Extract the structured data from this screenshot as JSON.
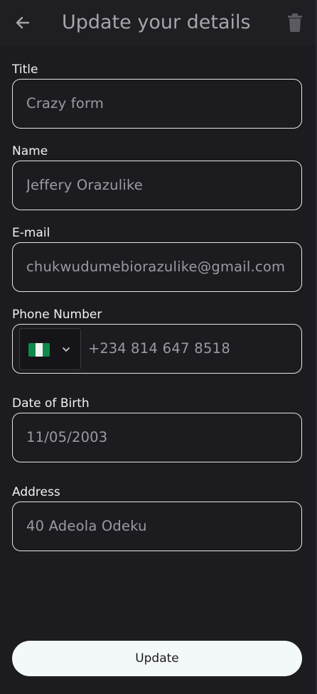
{
  "header": {
    "title": "Update your details",
    "back_icon": "arrow-left-icon",
    "delete_icon": "trash-icon"
  },
  "form": {
    "title": {
      "label": "Title",
      "value": "Crazy form"
    },
    "name": {
      "label": "Name",
      "value": "Jeffery Orazulike"
    },
    "email": {
      "label": "E-mail",
      "value": "chukwudumebiorazulike@gmail.com"
    },
    "phone": {
      "label": "Phone Number",
      "country_flag": "nigeria-flag-icon",
      "dial_code": "+234",
      "number": "814 647 8518"
    },
    "dob": {
      "label": "Date of Birth",
      "value": "11/05/2003"
    },
    "address": {
      "label": "Address",
      "value": "40 Adeola Odeku"
    }
  },
  "actions": {
    "update_label": "Update"
  },
  "colors": {
    "background": "#1c1b20",
    "header_text": "#a4a6aa",
    "label_text": "#f1f1f3",
    "input_text": "#9a9ba0",
    "border": "#e6e6ea",
    "button_bg": "#f3f8f8",
    "flag_green": "#0f8a4a"
  }
}
